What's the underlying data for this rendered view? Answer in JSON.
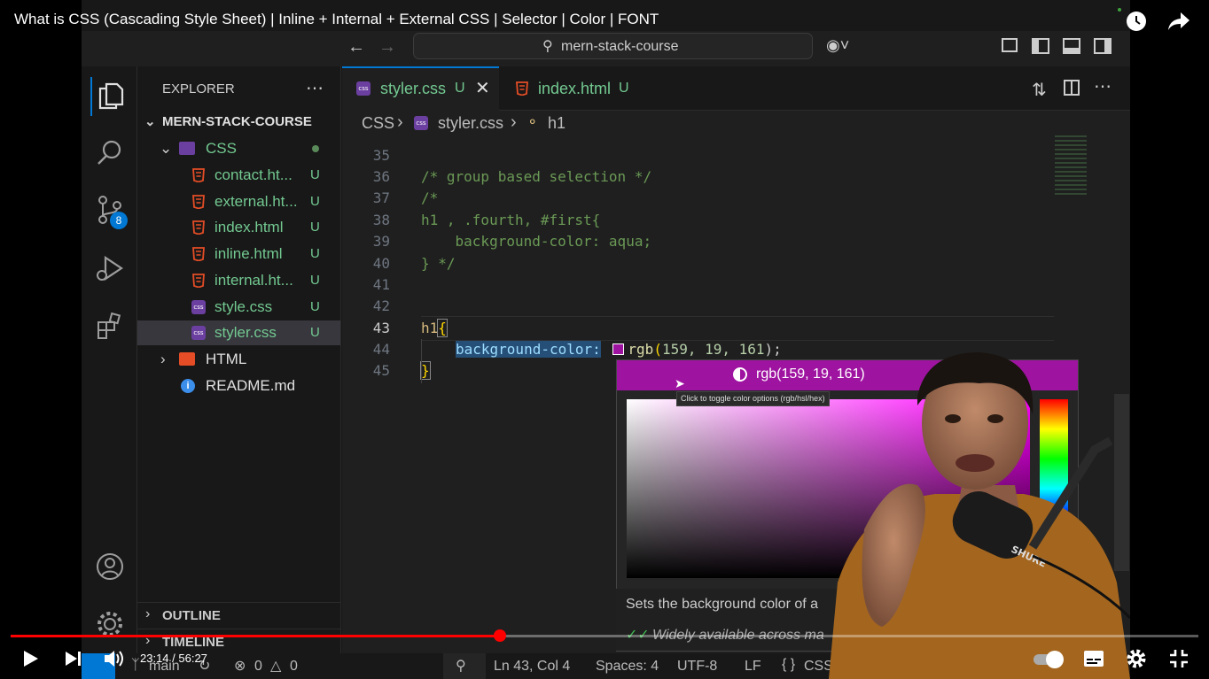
{
  "video": {
    "title": "What is CSS (Cascading Style Sheet) | Inline + Internal + External CSS | Selector | Color | FONT",
    "current_time": "23:14",
    "duration": "56:27",
    "time_display": "23:14 / 56:27",
    "progress": 0.412
  },
  "colors": {
    "accent": "#0078d4",
    "progress": "#ff0000",
    "picked": "#9f13a1"
  },
  "vscode": {
    "search_text": "mern-stack-course",
    "sidebar": {
      "title": "EXPLORER",
      "root": "MERN-STACK-COURSE",
      "folder_css": "CSS",
      "files": [
        {
          "name": "contact.ht...",
          "type": "html",
          "status": "U"
        },
        {
          "name": "external.ht...",
          "type": "html",
          "status": "U"
        },
        {
          "name": "index.html",
          "type": "html",
          "status": "U"
        },
        {
          "name": "inline.html",
          "type": "html",
          "status": "U"
        },
        {
          "name": "internal.ht...",
          "type": "html",
          "status": "U"
        },
        {
          "name": "style.css",
          "type": "css",
          "status": "U"
        },
        {
          "name": "styler.css",
          "type": "css",
          "status": "U"
        }
      ],
      "folder_html": "HTML",
      "readme": "README.md",
      "outline": "OUTLINE",
      "timeline": "TIMELINE",
      "scm_badge": "8"
    },
    "tabs": [
      {
        "label": "styler.css",
        "status": "U",
        "active": true
      },
      {
        "label": "index.html",
        "status": "U",
        "active": false
      }
    ],
    "breadcrumbs": {
      "folder": "CSS",
      "file": "styler.css",
      "symbol": "h1"
    },
    "code": {
      "line_numbers": [
        "35",
        "36",
        "37",
        "38",
        "39",
        "40",
        "41",
        "42",
        "43",
        "44",
        "45"
      ],
      "line36": "/* group based selection */",
      "line37": "/*",
      "line38": "h1 , .fourth, #first{",
      "line39": "    background-color: aqua;",
      "line40": "} */",
      "line43_selector": "h1",
      "line43_brace": "{",
      "line44_prop": "background-color:",
      "line44_fn": "rgb",
      "line44_open": "(",
      "line44_args": "159, 19, 161",
      "line44_close": ");",
      "line45": "}"
    },
    "color_picker": {
      "value": "rgb(159, 19, 161)",
      "tooltip": "Click to toggle color options (rgb/hsl/hex)"
    },
    "hover_doc": {
      "description": "Sets the background color of a",
      "baseline": "Widely available across ma"
    },
    "status": {
      "branch": "main",
      "errors": "0",
      "warnings": "0",
      "cursor": "Ln 43, Col 4",
      "spaces": "Spaces: 4",
      "encoding": "UTF-8",
      "eol": "LF",
      "language": "CSS"
    }
  }
}
